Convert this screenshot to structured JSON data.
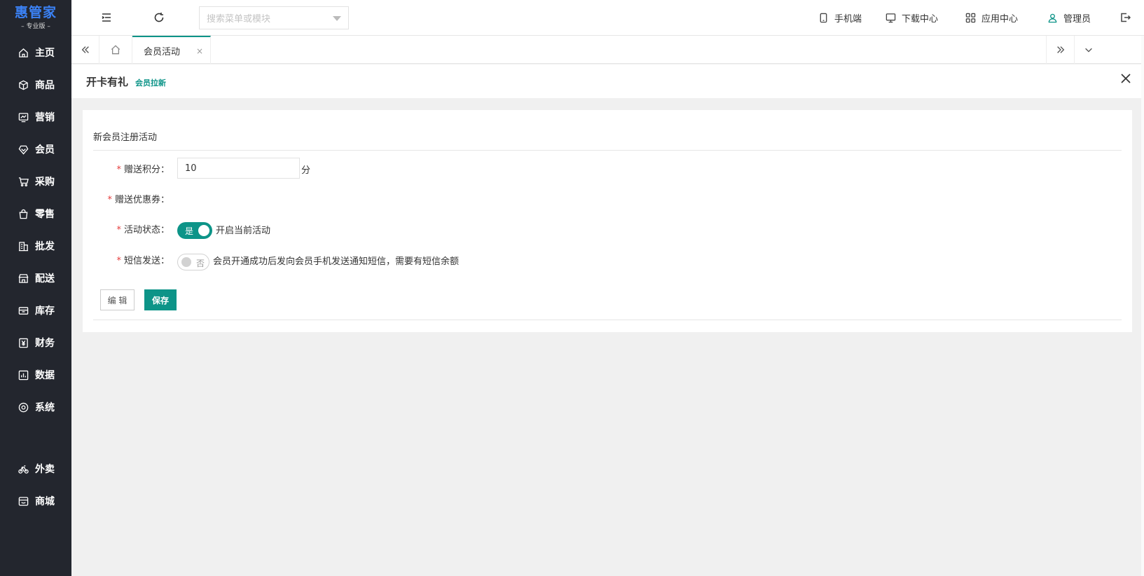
{
  "brand": {
    "name": "惠管家",
    "edition": "– 专业版 –",
    "logo_color": "#3b82f6"
  },
  "sidebar": {
    "items": [
      {
        "label": "主页",
        "icon": "home-icon"
      },
      {
        "label": "商品",
        "icon": "box-icon"
      },
      {
        "label": "营销",
        "icon": "trend-chart-icon"
      },
      {
        "label": "会员",
        "icon": "diamond-icon"
      },
      {
        "label": "采购",
        "icon": "cart-icon"
      },
      {
        "label": "零售",
        "icon": "shopping-bag-icon"
      },
      {
        "label": "批发",
        "icon": "building-icon"
      },
      {
        "label": "配送",
        "icon": "store-icon"
      },
      {
        "label": "库存",
        "icon": "archive-icon"
      },
      {
        "label": "财务",
        "icon": "yen-icon"
      },
      {
        "label": "数据",
        "icon": "bar-chart-icon"
      },
      {
        "label": "系统",
        "icon": "settings-icon"
      },
      {
        "label": "外卖",
        "icon": "bike-icon"
      },
      {
        "label": "商城",
        "icon": "shop-icon"
      }
    ]
  },
  "header": {
    "menu_search_placeholder": "搜索菜单或模块",
    "links": {
      "mobile": "手机端",
      "download": "下载中心",
      "apps": "应用中心",
      "user": "管理员"
    }
  },
  "tabs": {
    "active_label": "会员活动",
    "close_glyph": "×"
  },
  "page": {
    "title": "开卡有礼",
    "subtitle": "会员拉新",
    "close_glyph": "✕"
  },
  "form": {
    "section_title": "新会员注册活动",
    "points": {
      "label": "赠送积分：",
      "value": "10",
      "unit": "分"
    },
    "coupon": {
      "label": "赠送优惠券："
    },
    "status": {
      "label": "活动状态：",
      "switch_text": "是",
      "enabled": true,
      "hint": "开启当前活动"
    },
    "sms": {
      "label": "短信发送：",
      "switch_text": "否",
      "enabled": false,
      "hint": "会员开通成功后发向会员手机发送通知短信，需要有短信余额"
    },
    "required_mark": "*",
    "edit_button": "编 辑",
    "save_button": "保存"
  },
  "colors": {
    "accent": "#0d9488",
    "sidebar_bg": "#23262e",
    "required": "#e53e3e"
  }
}
